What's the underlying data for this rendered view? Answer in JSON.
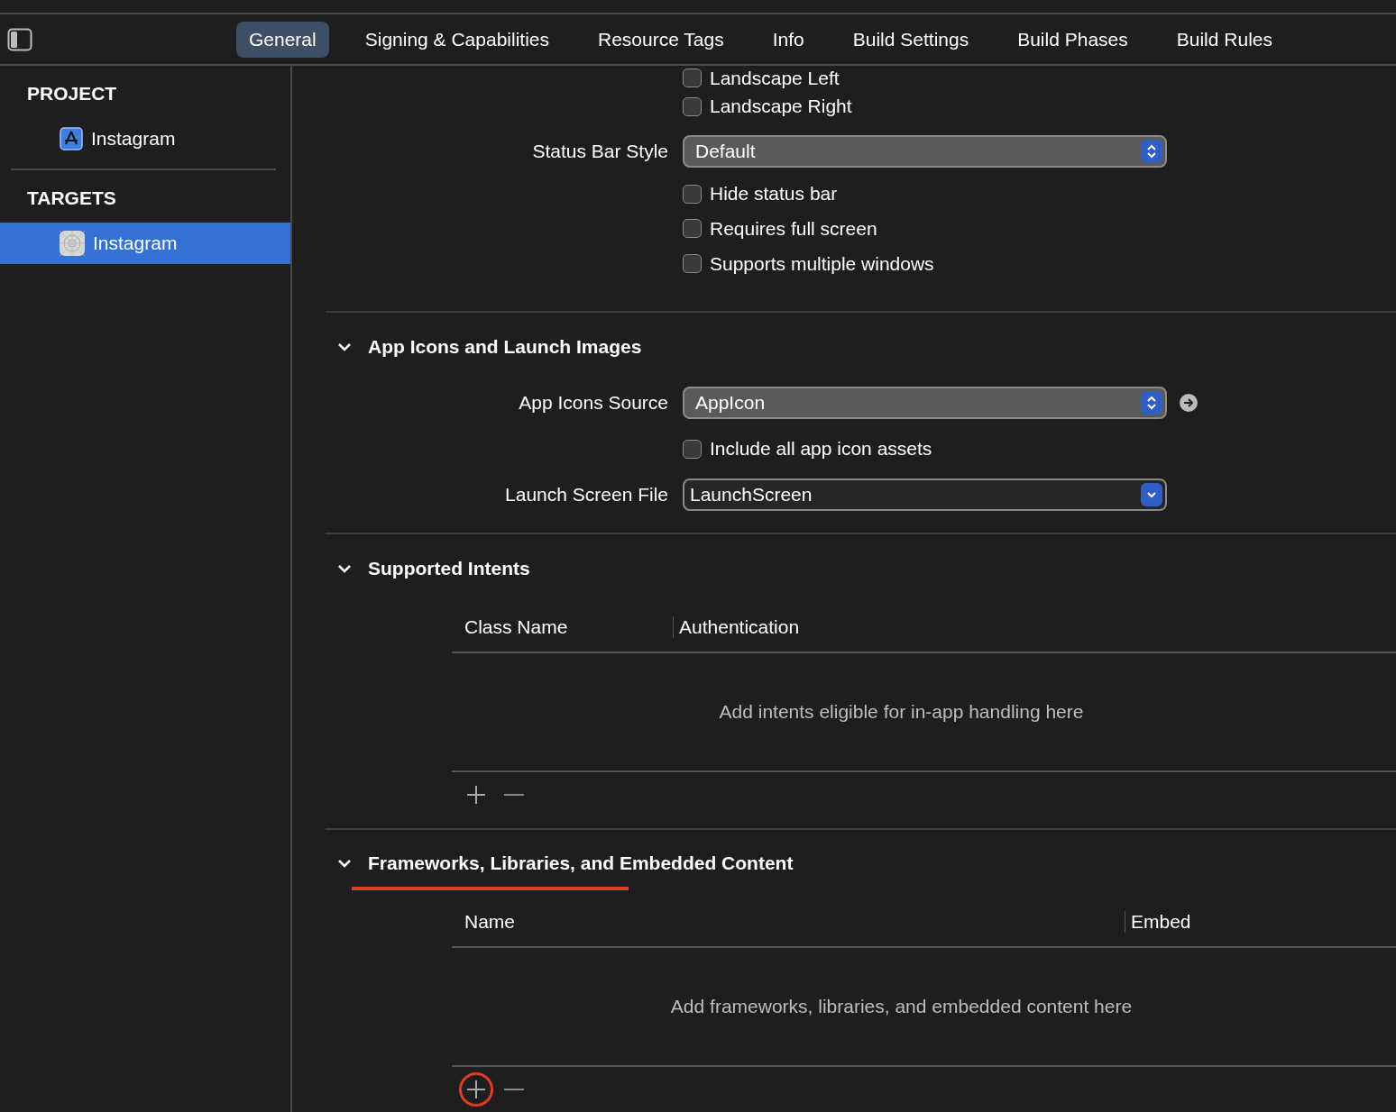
{
  "tabs": [
    {
      "label": "General",
      "selected": true
    },
    {
      "label": "Signing & Capabilities",
      "selected": false
    },
    {
      "label": "Resource Tags",
      "selected": false
    },
    {
      "label": "Info",
      "selected": false
    },
    {
      "label": "Build Settings",
      "selected": false
    },
    {
      "label": "Build Phases",
      "selected": false
    },
    {
      "label": "Build Rules",
      "selected": false
    }
  ],
  "sidebar": [
    {
      "heading": "PROJECT",
      "items": [
        {
          "label": "Instagram",
          "kind": "project",
          "selected": false
        }
      ]
    },
    {
      "heading": "TARGETS",
      "items": [
        {
          "label": "Instagram",
          "kind": "target",
          "selected": true
        }
      ]
    }
  ],
  "deployment_rows": [
    {
      "kind": "checkbox",
      "label": "Landscape Left",
      "checked": false
    },
    {
      "kind": "checkbox",
      "label": "Landscape Right",
      "checked": false
    },
    {
      "kind": "popup",
      "label": "Status Bar Style",
      "value": "Default"
    },
    {
      "kind": "checkbox",
      "label": "Hide status bar",
      "checked": false
    },
    {
      "kind": "checkbox",
      "label": "Requires full screen",
      "checked": false
    },
    {
      "kind": "checkbox",
      "label": "Supports multiple windows",
      "checked": false
    }
  ],
  "sections": [
    {
      "title": "App Icons and Launch Images",
      "expanded": true,
      "highlighted": false,
      "rows": [
        {
          "kind": "popup",
          "label": "App Icons Source",
          "value": "AppIcon",
          "link": true
        },
        {
          "kind": "checkbox",
          "label": "Include all app icon assets",
          "checked": false
        },
        {
          "kind": "combo",
          "label": "Launch Screen File",
          "value": "LaunchScreen"
        }
      ]
    },
    {
      "title": "Supported Intents",
      "expanded": true,
      "highlighted": false,
      "table": {
        "columns": [
          "Class Name",
          "Authentication"
        ],
        "empty": "Add intents eligible for in-app handling here",
        "add_highlighted": false
      }
    },
    {
      "title": "Frameworks, Libraries, and Embedded Content",
      "expanded": true,
      "highlighted": true,
      "table": {
        "columns": [
          "Name",
          "Embed"
        ],
        "empty": "Add frameworks, libraries, and embedded content here",
        "add_highlighted": true
      }
    }
  ]
}
